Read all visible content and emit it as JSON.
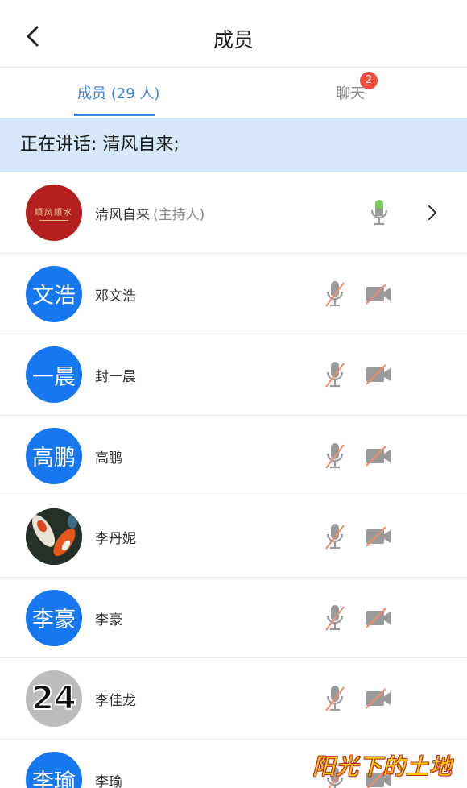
{
  "header": {
    "title": "成员"
  },
  "tabs": [
    {
      "label": "成员 (29 人)",
      "active": true
    },
    {
      "label": "聊天",
      "active": false,
      "badge": "2"
    }
  ],
  "speaking": {
    "text": "正在讲话: 清风自来;"
  },
  "members": [
    {
      "avatar_type": "image-seal",
      "avatar_text": "顺风顺水",
      "name": "清风自来",
      "role": "(主持人)",
      "mic": "on",
      "camera": "none"
    },
    {
      "avatar_type": "text",
      "avatar_text": "文浩",
      "name": "邓文浩",
      "role": "",
      "mic": "muted",
      "camera": "off"
    },
    {
      "avatar_type": "text",
      "avatar_text": "一晨",
      "name": "封一晨",
      "role": "",
      "mic": "muted",
      "camera": "off"
    },
    {
      "avatar_type": "text",
      "avatar_text": "高鹏",
      "name": "高鹏",
      "role": "",
      "mic": "muted",
      "camera": "off"
    },
    {
      "avatar_type": "image-koi",
      "avatar_text": "",
      "name": "李丹妮",
      "role": "",
      "mic": "muted",
      "camera": "off"
    },
    {
      "avatar_type": "text",
      "avatar_text": "李豪",
      "name": "李豪",
      "role": "",
      "mic": "muted",
      "camera": "off"
    },
    {
      "avatar_type": "image-number",
      "avatar_text": "24",
      "name": "李佳龙",
      "role": "",
      "mic": "muted",
      "camera": "off"
    },
    {
      "avatar_type": "text",
      "avatar_text": "李瑜",
      "name": "李瑜",
      "role": "",
      "mic": "muted",
      "camera": "off"
    }
  ],
  "watermark": "阳光下的土地",
  "colors": {
    "accent": "#3d84e8",
    "avatar_blue": "#1677f0",
    "speaking_bg": "#d7e8fb",
    "badge": "#f04c3c",
    "mic_on": "#7bc95a",
    "muted_slash": "#f08a6a"
  }
}
